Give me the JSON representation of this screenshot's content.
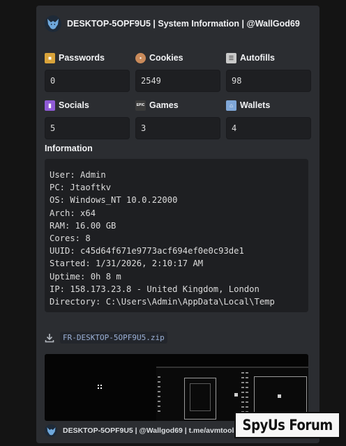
{
  "header": {
    "title": "DESKTOP-5OPF9U5 | System Information | @WallGod69"
  },
  "fields": [
    {
      "label": "Passwords",
      "value": "0",
      "icon": "lock-icon",
      "color": "#d9a33a"
    },
    {
      "label": "Cookies",
      "value": "2549",
      "icon": "cookie-icon",
      "color": "#c98a5a"
    },
    {
      "label": "Autofills",
      "value": "98",
      "icon": "clipboard-icon",
      "color": "#c9c9c9"
    },
    {
      "label": "Socials",
      "value": "5",
      "icon": "twitch-icon",
      "color": "#8f5bd6"
    },
    {
      "label": "Games",
      "value": "3",
      "icon": "epic-games-icon",
      "color": "#3a3a3a",
      "icon_text": "EPIC"
    },
    {
      "label": "Wallets",
      "value": "4",
      "icon": "bank-icon",
      "color": "#7fa7d8"
    }
  ],
  "information": {
    "title": "Information",
    "lines": [
      "User: Admin",
      "PC: Jtaoftkv",
      "OS: Windows_NT 10.0.22000",
      "Arch: x64",
      "RAM: 16.00 GB",
      "Cores: 8",
      "UUID: c45d64f671e9773acf694ef0e0c93de1",
      "Started: 1/31/2026, 2:10:17 AM",
      "Uptime: 0h 8 m",
      "IP: 158.173.23.8 - United Kingdom, London",
      "Directory: C:\\Users\\Admin\\AppData\\Local\\Temp"
    ]
  },
  "attachment": {
    "filename": "FR-DESKTOP-5OPF9U5.zip",
    "icon": "download-icon"
  },
  "footer": {
    "text": "DESKTOP-5OPF9U5 | @Wallgod69 | t.me/avmtools"
  },
  "watermark": {
    "text": "SpyUs Forum"
  },
  "colors": {
    "background": "#141414",
    "card": "#2b2d31",
    "code_box": "#1e1f22",
    "link": "#9bb0d6"
  }
}
